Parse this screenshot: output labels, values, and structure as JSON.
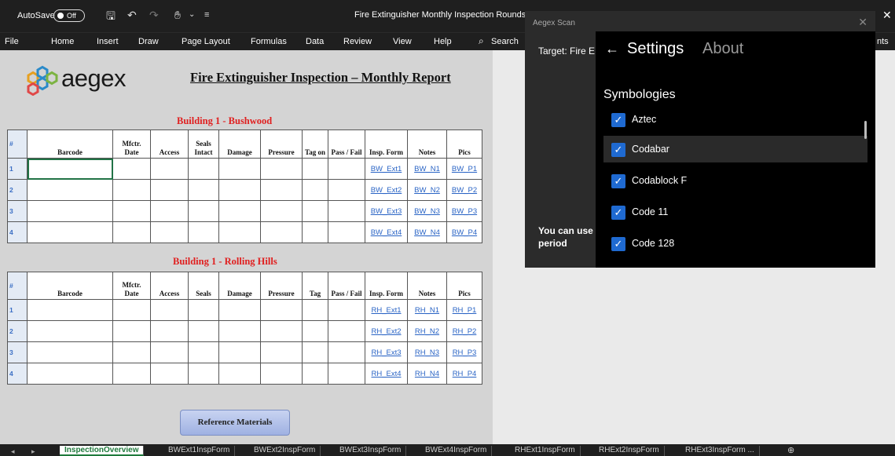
{
  "titlebar": {
    "autosave_label": "AutoSave",
    "autosave_state": "Off",
    "doc_title": "Fire Extinguisher Monthly Inspection Rounds",
    "close_glyph": "✕"
  },
  "ribbon": {
    "tabs": [
      "File",
      "Home",
      "Insert",
      "Draw",
      "Page Layout",
      "Formulas",
      "Data",
      "Review",
      "View",
      "Help"
    ],
    "search_label": "Search",
    "overflow_text": "nts"
  },
  "sheet": {
    "logo_text": "aegex",
    "report_title": "Fire Extinguisher Inspection – Monthly Report",
    "sections": [
      {
        "title": "Building 1 - Bushwood",
        "headers": [
          "#",
          "Barcode",
          "Mfctr. Date",
          "Access",
          "Seals Intact",
          "Damage",
          "Pressure",
          "Tag on",
          "Pass / Fail",
          "Insp. Form",
          "Notes",
          "Pics"
        ],
        "rows": [
          {
            "n": "1",
            "form": "BW_Ext1",
            "notes": "BW_N1",
            "pics": "BW_P1"
          },
          {
            "n": "2",
            "form": "BW_Ext2",
            "notes": "BW_N2",
            "pics": "BW_P2"
          },
          {
            "n": "3",
            "form": "BW_Ext3",
            "notes": "BW_N3",
            "pics": "BW_P3"
          },
          {
            "n": "4",
            "form": "BW_Ext4",
            "notes": "BW_N4",
            "pics": "BW_P4"
          }
        ]
      },
      {
        "title": "Building 1 - Rolling Hills",
        "headers": [
          "#",
          "Barcode",
          "Mfctr. Date",
          "Access",
          "Seals",
          "Damage",
          "Pressure",
          "Tag",
          "Pass / Fail",
          "Insp. Form",
          "Notes",
          "Pics"
        ],
        "rows": [
          {
            "n": "1",
            "form": "RH_Ext1",
            "notes": "RH_N1",
            "pics": "RH_P1"
          },
          {
            "n": "2",
            "form": "RH_Ext2",
            "notes": "RH_N2",
            "pics": "RH_P2"
          },
          {
            "n": "3",
            "form": "RH_Ext3",
            "notes": "RH_N3",
            "pics": "RH_P3"
          },
          {
            "n": "4",
            "form": "RH_Ext4",
            "notes": "RH_N4",
            "pics": "RH_P4"
          }
        ]
      }
    ],
    "reference_button": "Reference Materials"
  },
  "sheet_tabs": [
    "InspectionOverview",
    "BWExt1InspForm",
    "BWExt2InspForm",
    "BWExt3InspForm",
    "BWExt4InspForm",
    "RHExt1InspForm",
    "RHExt2InspForm",
    "RHExt3InspForm ..."
  ],
  "scan_panel": {
    "title": "Aegex Scan",
    "target_text": "Target: Fire E",
    "trial_text": "You can use trial period"
  },
  "settings": {
    "back_glyph": "←",
    "settings_tab": "Settings",
    "about_tab": "About",
    "symbologies_header": "Symbologies",
    "symbologies": [
      {
        "label": "Aztec",
        "checked": true
      },
      {
        "label": "Codabar",
        "checked": true
      },
      {
        "label": "Codablock F",
        "checked": true
      },
      {
        "label": "Code 11",
        "checked": true
      },
      {
        "label": "Code 128",
        "checked": true
      }
    ]
  },
  "colors": {
    "accent": "#217346",
    "link": "#2a64c5",
    "section_title": "#e02020",
    "checkbox": "#1f6ad1"
  }
}
